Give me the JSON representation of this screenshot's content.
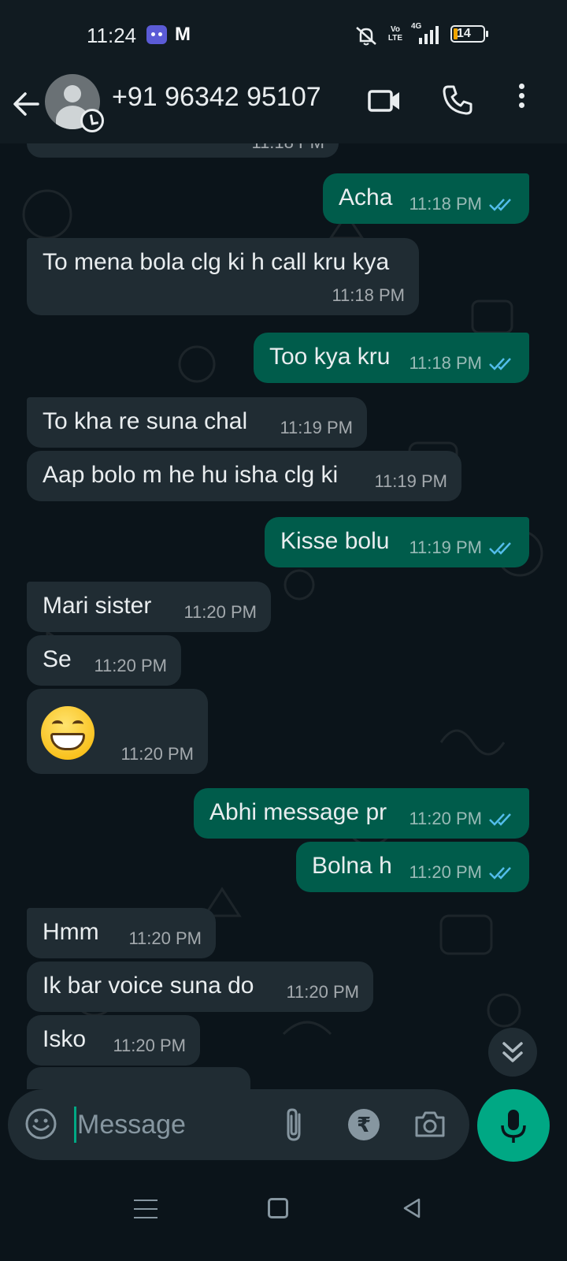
{
  "status_bar": {
    "time": "11:24",
    "app_letter": "M",
    "network_volte": "Vo LTE",
    "network_type": "4G",
    "battery_level": "14",
    "battery_color": "#f0a500"
  },
  "header": {
    "contact_name": "+91 96342 95107",
    "icons": [
      "back-arrow-icon",
      "avatar",
      "video-call-icon",
      "voice-call-icon",
      "more-options-icon"
    ]
  },
  "messages": [
    {
      "direction": "in",
      "text": "",
      "time": "11:18 PM",
      "partial": true
    },
    {
      "direction": "out",
      "text": "Acha",
      "time": "11:18 PM",
      "read": true
    },
    {
      "direction": "in",
      "text": "To mena bola clg ki h call kru kya",
      "time": "11:18 PM"
    },
    {
      "direction": "out",
      "text": "Too kya kru",
      "time": "11:18 PM",
      "read": true
    },
    {
      "direction": "in",
      "text": "To kha re suna chal",
      "time": "11:19 PM"
    },
    {
      "direction": "in",
      "text": "Aap bolo m he hu isha clg ki",
      "time": "11:19 PM"
    },
    {
      "direction": "out",
      "text": "Kisse bolu",
      "time": "11:19 PM",
      "read": true
    },
    {
      "direction": "in",
      "text": "Mari sister",
      "time": "11:20 PM"
    },
    {
      "direction": "in",
      "text": "Se",
      "time": "11:20 PM"
    },
    {
      "direction": "in",
      "text": "😁",
      "time": "11:20 PM",
      "emoji": "grinning-face"
    },
    {
      "direction": "out",
      "text": "Abhi message pr",
      "time": "11:20 PM",
      "read": true
    },
    {
      "direction": "out",
      "text": "Bolna h",
      "time": "11:20 PM",
      "read": true
    },
    {
      "direction": "in",
      "text": "Hmm",
      "time": "11:20 PM"
    },
    {
      "direction": "in",
      "text": "Ik bar voice suna do",
      "time": "11:20 PM"
    },
    {
      "direction": "in",
      "text": "Isko",
      "time": "11:20 PM"
    },
    {
      "direction": "in",
      "text": "",
      "time": "",
      "partial": true
    }
  ],
  "input": {
    "placeholder": "Message",
    "value": "",
    "rupee_symbol": "₹"
  },
  "colors": {
    "background": "#0b141a",
    "header": "#111b21",
    "incoming_bubble": "#202c33",
    "outgoing_bubble": "#005c4b",
    "accent": "#00a884",
    "read_ticks": "#53bdeb"
  }
}
